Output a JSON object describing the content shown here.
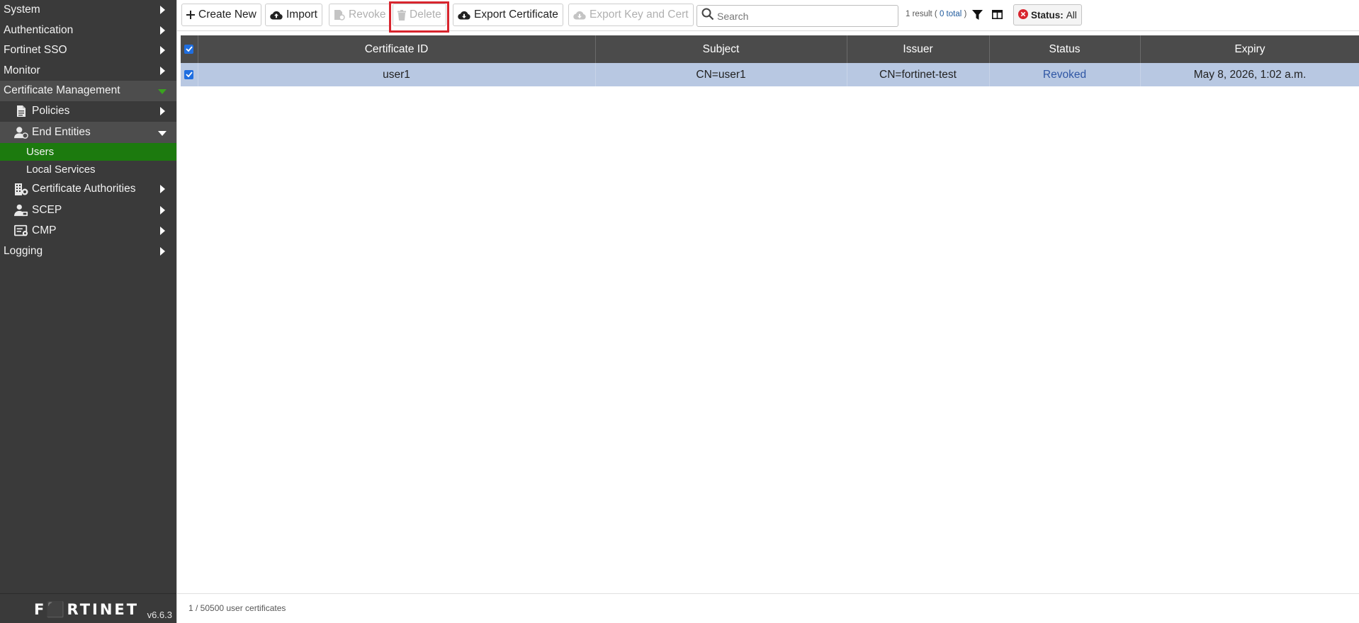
{
  "sidebar": {
    "items": [
      {
        "label": "System"
      },
      {
        "label": "Authentication"
      },
      {
        "label": "Fortinet SSO"
      },
      {
        "label": "Monitor"
      },
      {
        "label": "Certificate Management"
      },
      {
        "label": "Policies"
      },
      {
        "label": "End Entities"
      },
      {
        "label": "Users"
      },
      {
        "label": "Local Services"
      },
      {
        "label": "Certificate Authorities"
      },
      {
        "label": "SCEP"
      },
      {
        "label": "CMP"
      },
      {
        "label": "Logging"
      }
    ],
    "logo": "F⬛RTINET",
    "version": "v6.6.3"
  },
  "toolbar": {
    "create_new": "Create New",
    "import": "Import",
    "revoke": "Revoke",
    "delete": "Delete",
    "export_certificate": "Export Certificate",
    "export_key_and_cert": "Export Key and Cert",
    "search_placeholder": "Search",
    "result_prefix": "1 result (",
    "result_total": " 0 total ",
    "result_suffix": ")",
    "status_filter_key": "Status:",
    "status_filter_value": "All"
  },
  "table": {
    "columns": [
      "Certificate ID",
      "Subject",
      "Issuer",
      "Status",
      "Expiry"
    ],
    "rows": [
      {
        "certificate_id": "user1",
        "subject": "CN=user1",
        "issuer": "CN=fortinet-test",
        "status": "Revoked",
        "expiry": "May 8, 2026, 1:02 a.m."
      }
    ]
  },
  "footer": {
    "summary": "1 / 50500 user certificates"
  },
  "colors": {
    "sidebar_bg": "#3a3a3a",
    "active_green": "#1c7a0e",
    "header_bg": "#4b4b4b",
    "selected_row": "#b8c8e2",
    "highlight_red": "#d8252e"
  }
}
